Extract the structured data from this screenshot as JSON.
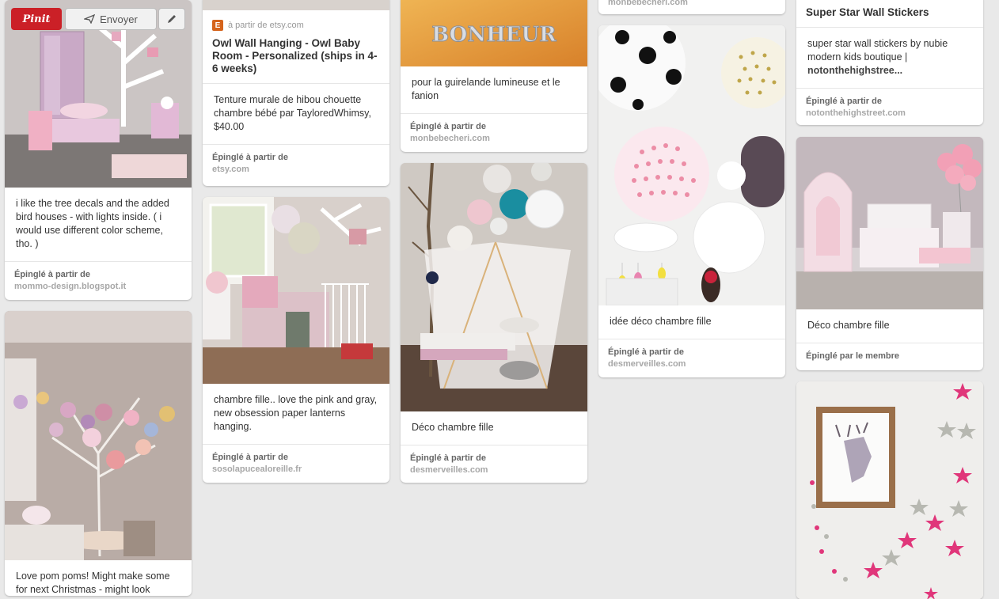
{
  "buttons": {
    "pinit": "Pinit",
    "send": "Envoyer"
  },
  "col1": {
    "pin1": {
      "desc": "i like the tree decals and the added bird houses - with lights inside. ( i would use different color scheme, tho. )",
      "src_label": "Épinglé à partir de",
      "src_domain": "mommo-design.blogspot.it"
    },
    "pin2": {
      "desc": "Love pom poms! Might make some for next Christmas - might look"
    }
  },
  "col2": {
    "pin1": {
      "via": "à partir de etsy.com",
      "title": "Owl Wall Hanging - Owl Baby Room - Personalized (ships in 4-6 weeks)",
      "desc": "Tenture murale de hibou chouette chambre bébé par TayloredWhimsy, $40.00",
      "src_label": "Épinglé à partir de",
      "src_domain": "etsy.com"
    },
    "pin2": {
      "desc": "chambre fille.. love the pink and gray, new obsession paper lanterns hanging.",
      "src_label": "Épinglé à partir de",
      "src_domain": "sosolapucealoreille.fr"
    }
  },
  "col3": {
    "pin1": {
      "sign_text": "BONHEUR",
      "desc": "pour la guirelande lumineuse et le fanion",
      "src_label": "Épinglé à partir de",
      "src_domain": "monbebecheri.com"
    },
    "pin2": {
      "desc": "Déco chambre fille",
      "src_label": "Épinglé à partir de",
      "src_domain": "desmerveilles.com"
    }
  },
  "col4": {
    "pin0": {
      "src_domain": "monbebecheri.com"
    },
    "pin1": {
      "desc": "idée déco chambre fille",
      "src_label": "Épinglé à partir de",
      "src_domain": "desmerveilles.com"
    }
  },
  "col5": {
    "pin1": {
      "title": "Super Star Wall Stickers",
      "desc_main": "super star wall stickers by nubie modern kids boutique | ",
      "desc_bold": "notonthehighstree...",
      "src_label": "Épinglé à partir de",
      "src_domain": "notonthehighstreet.com"
    },
    "pin2": {
      "desc": "Déco chambre fille",
      "src_label": "Épinglé par le membre"
    }
  }
}
